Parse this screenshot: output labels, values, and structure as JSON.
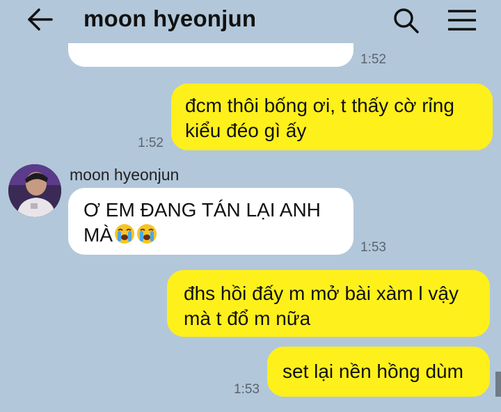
{
  "header": {
    "title": "moon hyeonjun",
    "back_icon": "arrow-left-icon",
    "search_icon": "search-icon",
    "menu_icon": "hamburger-menu-icon"
  },
  "colors": {
    "background": "#b2c7da",
    "incoming_bubble": "#ffffff",
    "outgoing_bubble": "#fef01b"
  },
  "messages": [
    {
      "direction": "incoming",
      "text": "",
      "time": "1:52"
    },
    {
      "direction": "outgoing",
      "lines": [
        "đcm thôi bống ơi, t thấy cờ rỉng",
        "kiểu đéo gì ấy"
      ],
      "time": "1:52"
    },
    {
      "direction": "incoming",
      "sender": "moon hyeonjun",
      "lines": [
        "Ơ EM ĐANG TÁN LẠI ANH",
        "MÀ"
      ],
      "emojis": [
        "loudly-crying-face-emoji",
        "loudly-crying-face-emoji"
      ],
      "time": "1:53"
    },
    {
      "direction": "outgoing",
      "lines": [
        "đhs hồi đấy m mở bài xàm l vậy",
        "mà t đổ m nữa"
      ],
      "time": ""
    },
    {
      "direction": "outgoing",
      "lines": [
        "set lại nền hồng dùm"
      ],
      "time": "1:53"
    }
  ]
}
